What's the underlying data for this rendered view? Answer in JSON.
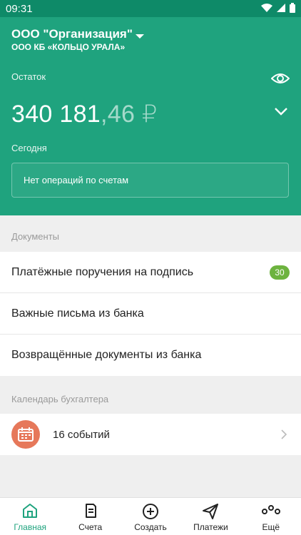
{
  "status_bar": {
    "time": "09:31"
  },
  "header": {
    "org_name": "ООО \"Организация\"",
    "bank_name": "ООО КБ «КОЛЬЦО УРАЛА»",
    "balance_label": "Остаток",
    "balance_int": "340 181",
    "balance_frac": ",46 ₽",
    "today_label": "Сегодня",
    "no_operations": "Нет операций по счетам"
  },
  "documents": {
    "title": "Документы",
    "items": [
      {
        "label": "Платёжные поручения на подпись",
        "badge": "30"
      },
      {
        "label": "Важные письма из банка"
      },
      {
        "label": "Возвращённые документы из банка"
      }
    ]
  },
  "calendar": {
    "title": "Календарь бухгалтера",
    "events_label": "16 событий"
  },
  "tabs": [
    {
      "label": "Главная",
      "icon": "home-icon",
      "active": true
    },
    {
      "label": "Счета",
      "icon": "document-icon"
    },
    {
      "label": "Создать",
      "icon": "plus-circle-icon"
    },
    {
      "label": "Платежи",
      "icon": "paper-plane-icon"
    },
    {
      "label": "Ещё",
      "icon": "more-icon"
    }
  ],
  "colors": {
    "brand": "#1fa37e",
    "status_bar": "#0e8a68",
    "badge": "#6db33f",
    "calendar_icon": "#e6785a"
  }
}
